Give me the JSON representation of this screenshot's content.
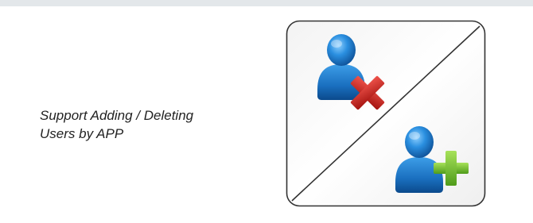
{
  "feature": {
    "caption_line1": "Support Adding / Deleting",
    "caption_line2": "Users by APP"
  },
  "illustration": {
    "upper_icon": "user-delete-icon",
    "lower_icon": "user-add-icon",
    "colors": {
      "user": "#1f78c8",
      "delete": "#c8201c",
      "add": "#6cb52b",
      "border": "#333333"
    }
  }
}
